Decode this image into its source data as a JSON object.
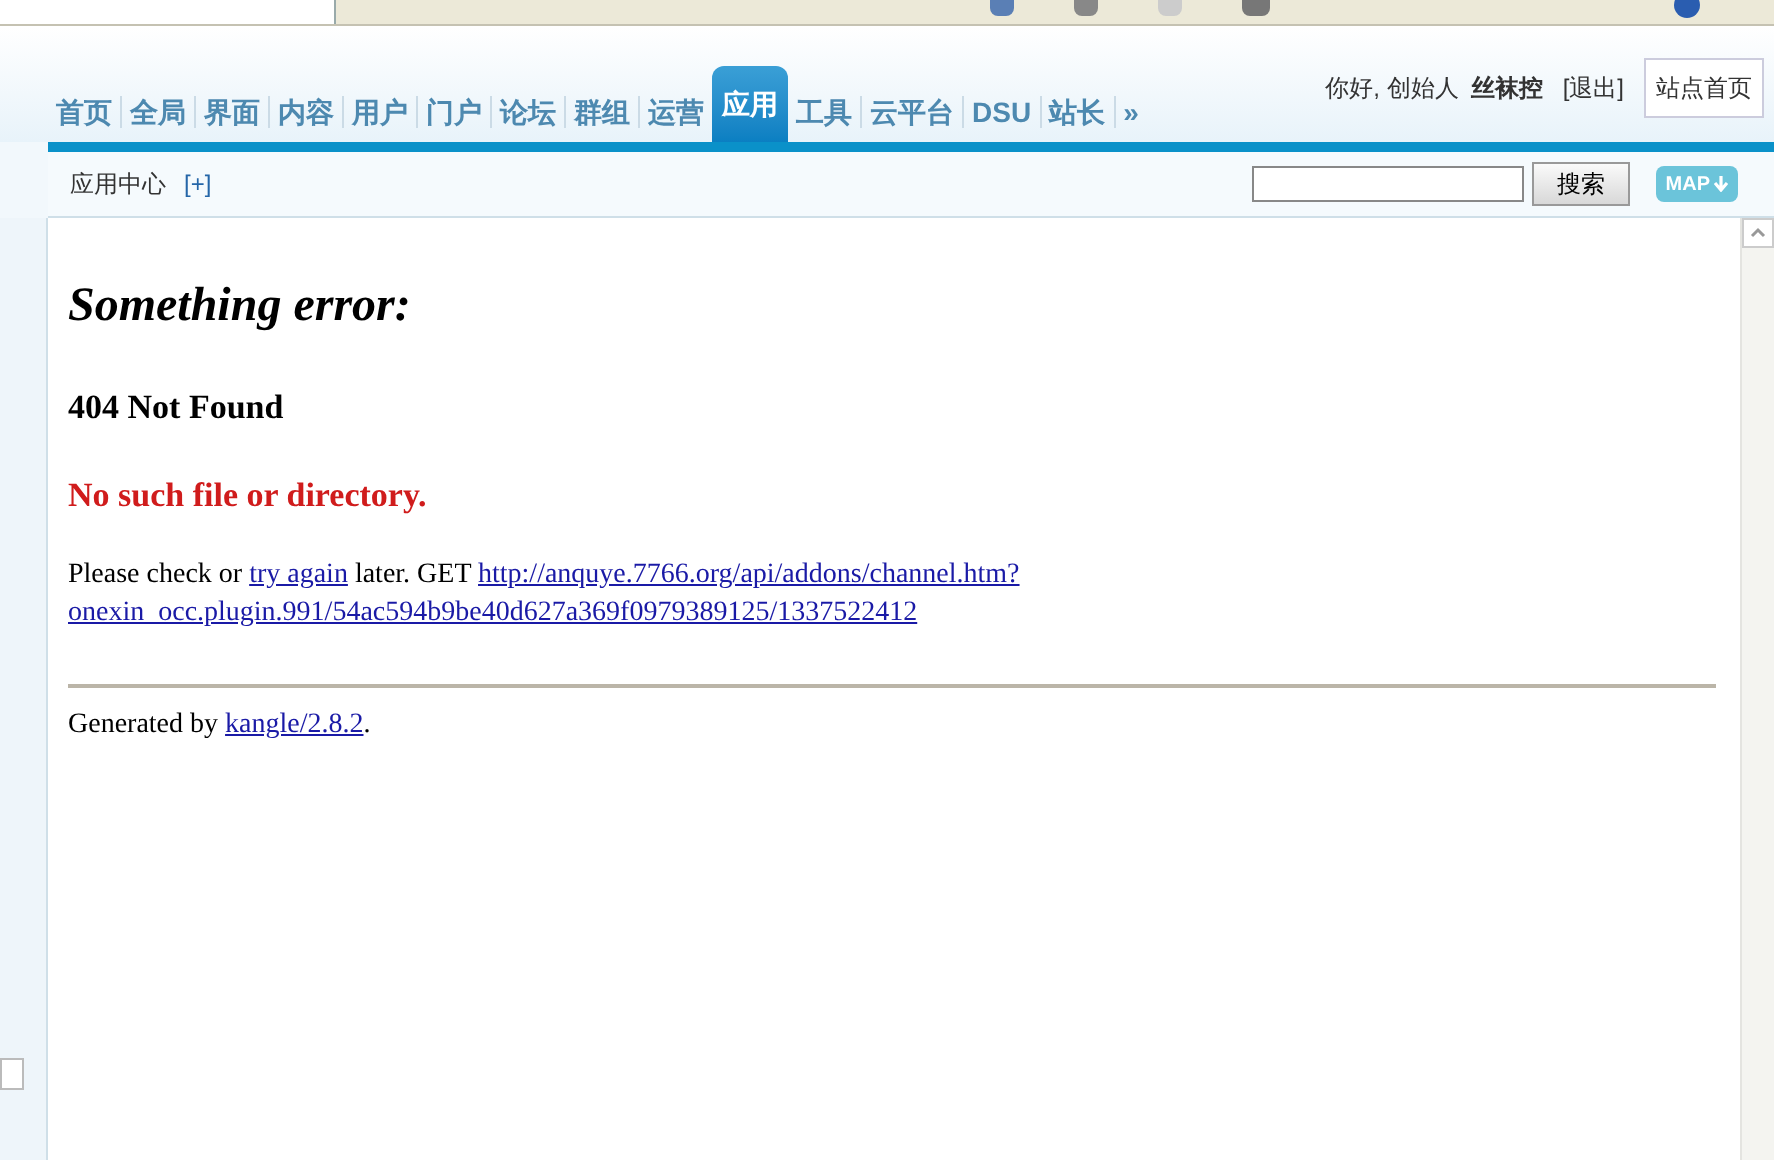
{
  "nav": {
    "tabs": [
      {
        "label": "首页",
        "selected": false
      },
      {
        "label": "全局",
        "selected": false
      },
      {
        "label": "界面",
        "selected": false
      },
      {
        "label": "内容",
        "selected": false
      },
      {
        "label": "用户",
        "selected": false
      },
      {
        "label": "门户",
        "selected": false
      },
      {
        "label": "论坛",
        "selected": false
      },
      {
        "label": "群组",
        "selected": false
      },
      {
        "label": "运营",
        "selected": false
      },
      {
        "label": "应用",
        "selected": true
      },
      {
        "label": "工具",
        "selected": false
      },
      {
        "label": "云平台",
        "selected": false
      },
      {
        "label": "DSU",
        "selected": false
      },
      {
        "label": "站长",
        "selected": false
      },
      {
        "label": "»",
        "selected": false
      }
    ],
    "greeting": "你好, 创始人",
    "username": "丝袜控",
    "logout": "[退出]",
    "home_button": "站点首页"
  },
  "subbar": {
    "title": "应用中心",
    "add": "[+]",
    "search_button": "搜索",
    "map_button": "MAP"
  },
  "error_page": {
    "heading": "Something error:",
    "status": "404 Not Found",
    "message": "No such file or directory.",
    "text_before": "Please check or ",
    "retry_link": "try again",
    "text_middle": " later. GET ",
    "url_lines": [
      "http://anquye.7766.org/api/addons/channel.htm?",
      "onexin_occ.plugin.991/54ac594b9be40d627a369f0979389125/1337522412"
    ],
    "footer_before": "Generated by ",
    "footer_link": "kangle/2.8.2",
    "footer_after": "."
  }
}
